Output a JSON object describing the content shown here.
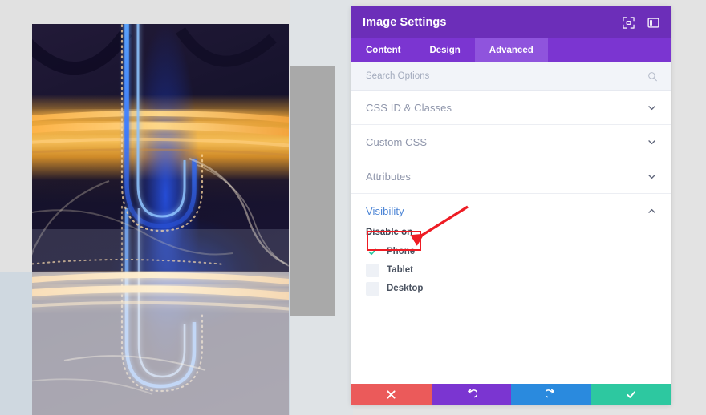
{
  "panel": {
    "title": "Image Settings",
    "header_icons": [
      {
        "name": "fullscreen-icon",
        "label": "Fullscreen"
      },
      {
        "name": "layout-toggle-icon",
        "label": "Panel Layout"
      }
    ],
    "tabs": [
      {
        "label": "Content",
        "active": false
      },
      {
        "label": "Design",
        "active": false
      },
      {
        "label": "Advanced",
        "active": true
      }
    ],
    "search": {
      "placeholder": "Search Options",
      "value": "",
      "icon": "search-icon"
    },
    "sections": [
      {
        "label": "CSS ID & Classes",
        "open": false,
        "chevron": "chevron-down-icon"
      },
      {
        "label": "Custom CSS",
        "open": false,
        "chevron": "chevron-down-icon"
      },
      {
        "label": "Attributes",
        "open": false,
        "chevron": "chevron-down-icon"
      },
      {
        "label": "Visibility",
        "open": true,
        "chevron": "chevron-up-icon"
      }
    ],
    "visibility": {
      "field_label": "Disable on",
      "options": [
        {
          "label": "Phone",
          "checked": true
        },
        {
          "label": "Tablet",
          "checked": false
        },
        {
          "label": "Desktop",
          "checked": false
        }
      ]
    },
    "actions": [
      {
        "name": "cancel-button",
        "icon": "close-icon",
        "color": "#eb5a5a"
      },
      {
        "name": "undo-button",
        "icon": "undo-icon",
        "color": "#7b35d1"
      },
      {
        "name": "redo-button",
        "icon": "redo-icon",
        "color": "#2a8ade"
      },
      {
        "name": "save-button",
        "icon": "check-icon",
        "color": "#2dc8a0"
      }
    ]
  },
  "annotation": {
    "highlight_color": "#ee1c24",
    "target": "Phone"
  },
  "canvas": {
    "image_alt": "Aerial night photo of a highway interchange with light trails",
    "placeholder_label": ""
  },
  "colors": {
    "header_purple": "#6c2eb9",
    "tab_purple": "#7b35d1",
    "tab_active_purple": "#8f54dd",
    "section_open_blue": "#4e86d6",
    "checkmark_teal": "#2dc8a0"
  }
}
